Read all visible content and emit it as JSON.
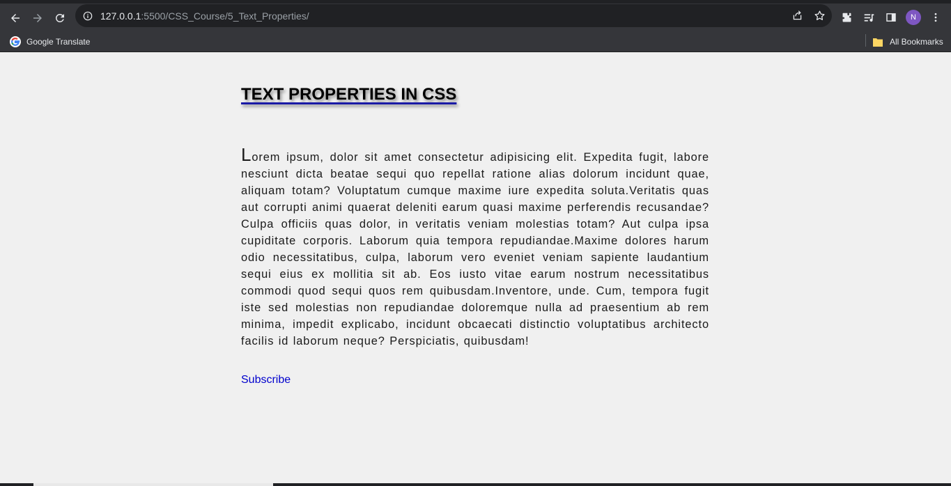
{
  "browser": {
    "url_host": "127.0.0.1",
    "url_rest": ":5500/CSS_Course/5_Text_Properties/",
    "avatar_letter": "N",
    "bookmarks": {
      "google_translate": "Google Translate",
      "all_bookmarks": "All Bookmarks"
    }
  },
  "page": {
    "title": "TEXT PROPERTIES IN CSS",
    "paragraph_first_letter": "L",
    "paragraph_rest": "orem ipsum, dolor sit amet consectetur adipisicing elit. Expedita fugit, labore nesciunt dicta beatae sequi quo repellat ratione alias dolorum incidunt quae, aliquam totam? Voluptatum cumque maxime iure expedita soluta.Veritatis quas aut corrupti animi quaerat deleniti earum quasi maxime perferendis recusandae? Culpa officiis quas dolor, in veritatis veniam molestias totam? Aut culpa ipsa cupiditate corporis. Laborum quia tempora repudiandae.Maxime dolores harum odio necessitatibus, culpa, laborum vero eveniet veniam sapiente laudantium sequi eius ex mollitia sit ab. Eos iusto vitae earum nostrum necessitatibus commodi quod sequi quos rem quibusdam.Inventore, unde. Cum, tempora fugit iste sed molestias non repudiandae doloremque nulla ad praesentium ab rem minima, impedit explicabo, incidunt obcaecati distinctio voluptatibus architecto facilis id laborum neque? Perspiciatis, quibusdam!",
    "link_text": "Subscribe"
  },
  "colors": {
    "chrome_bg": "#35363a",
    "omnibox_bg": "#202124",
    "page_bg": "#f0f0f0",
    "link": "#0000cd",
    "title_underline": "#1a1aa6"
  }
}
